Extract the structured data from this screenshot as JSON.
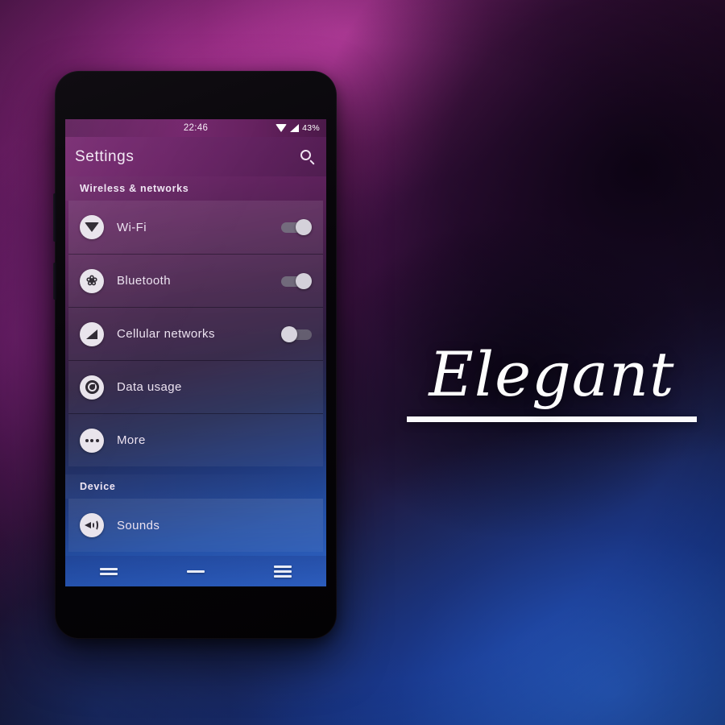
{
  "wallpaper": {
    "colors": {
      "purple": "#7d2275",
      "magenta": "#c53caa",
      "deep_purple": "#3a1140",
      "dark": "#0a0414",
      "blue": "#1c49a8",
      "bright_blue": "#2f63c4"
    }
  },
  "wordmark": {
    "text": "Elegant",
    "underline_color": "#fbfbfd"
  },
  "phone": {
    "statusbar": {
      "clock": "22:46",
      "battery_percent": "43%",
      "icons": [
        "wifi-icon",
        "signal-icon"
      ]
    },
    "actionbar": {
      "title": "Settings",
      "search_icon": "search-icon"
    },
    "sections": [
      {
        "header": "Wireless & networks",
        "rows": [
          {
            "icon": "wifi-icon",
            "label": "Wi-Fi",
            "toggle": "on"
          },
          {
            "icon": "bluetooth-icon",
            "label": "Bluetooth",
            "toggle": "on"
          },
          {
            "icon": "cellular-icon",
            "label": "Cellular networks",
            "toggle": "off"
          },
          {
            "icon": "data-usage-icon",
            "label": "Data usage",
            "toggle": null
          },
          {
            "icon": "more-icon",
            "label": "More",
            "toggle": null
          }
        ]
      },
      {
        "header": "Device",
        "rows": [
          {
            "icon": "sound-icon",
            "label": "Sounds",
            "toggle": null
          }
        ]
      }
    ],
    "navbar": {
      "back_label": "Back",
      "home_label": "Home",
      "recents_label": "Recents"
    }
  }
}
